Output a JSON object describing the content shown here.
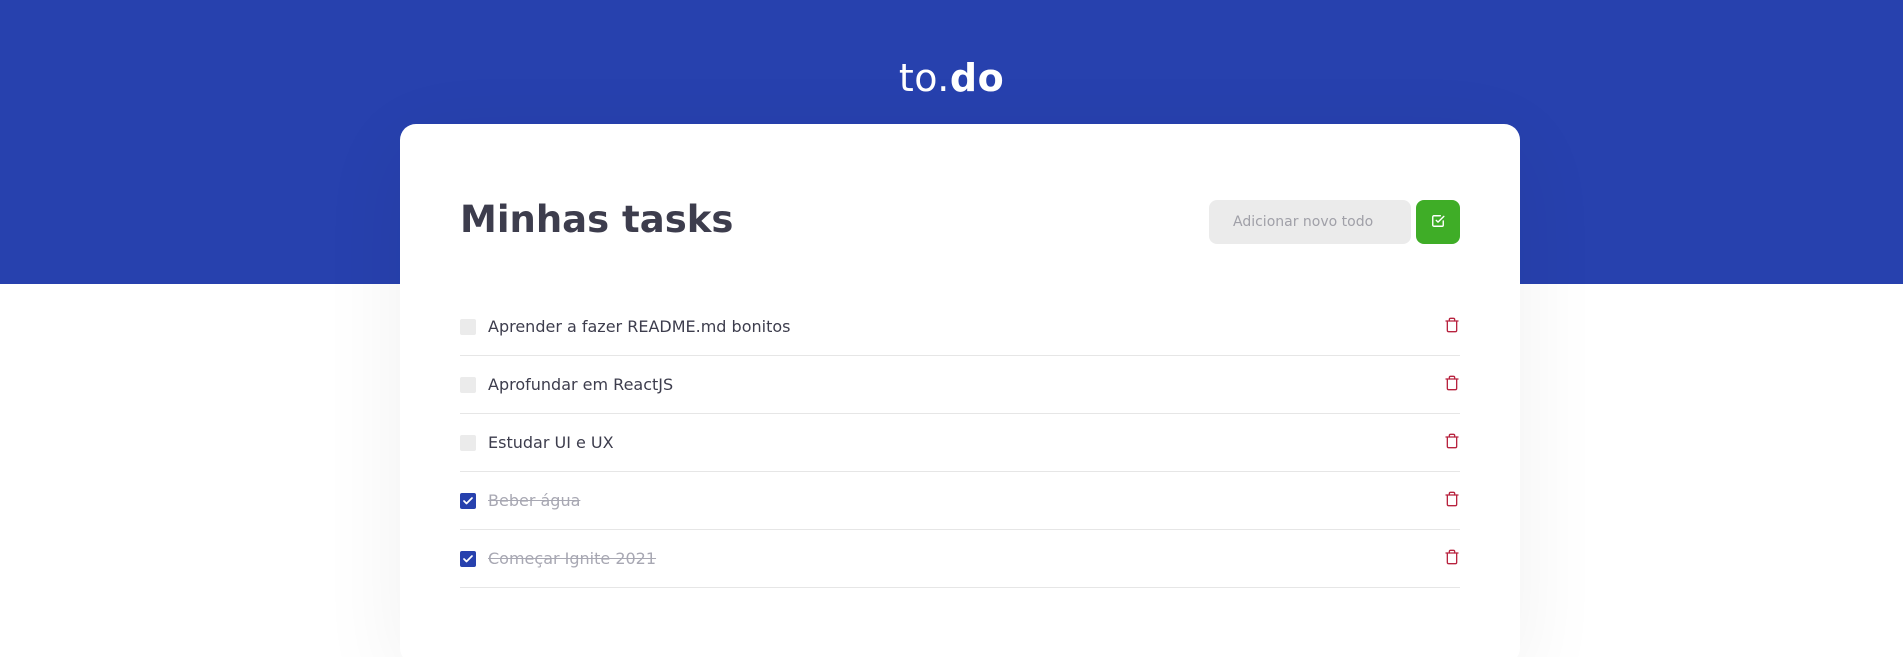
{
  "header": {
    "logo_light": "to.",
    "logo_bold": "do",
    "background_color": "#2741ae"
  },
  "main": {
    "title": "Minhas tasks",
    "new_todo": {
      "placeholder": "Adicionar novo todo",
      "value": ""
    },
    "add_button_icon": "check-square-icon",
    "add_button_color": "#3fad27",
    "delete_icon": "trash-icon",
    "delete_icon_color": "#b8233f",
    "check_color": "#2741ae"
  },
  "tasks": [
    {
      "title": "Aprender a fazer README.md bonitos",
      "completed": false
    },
    {
      "title": "Aprofundar em ReactJS",
      "completed": false
    },
    {
      "title": "Estudar UI e UX",
      "completed": false
    },
    {
      "title": "Beber água",
      "completed": true
    },
    {
      "title": "Começar Ignite 2021",
      "completed": true
    }
  ]
}
